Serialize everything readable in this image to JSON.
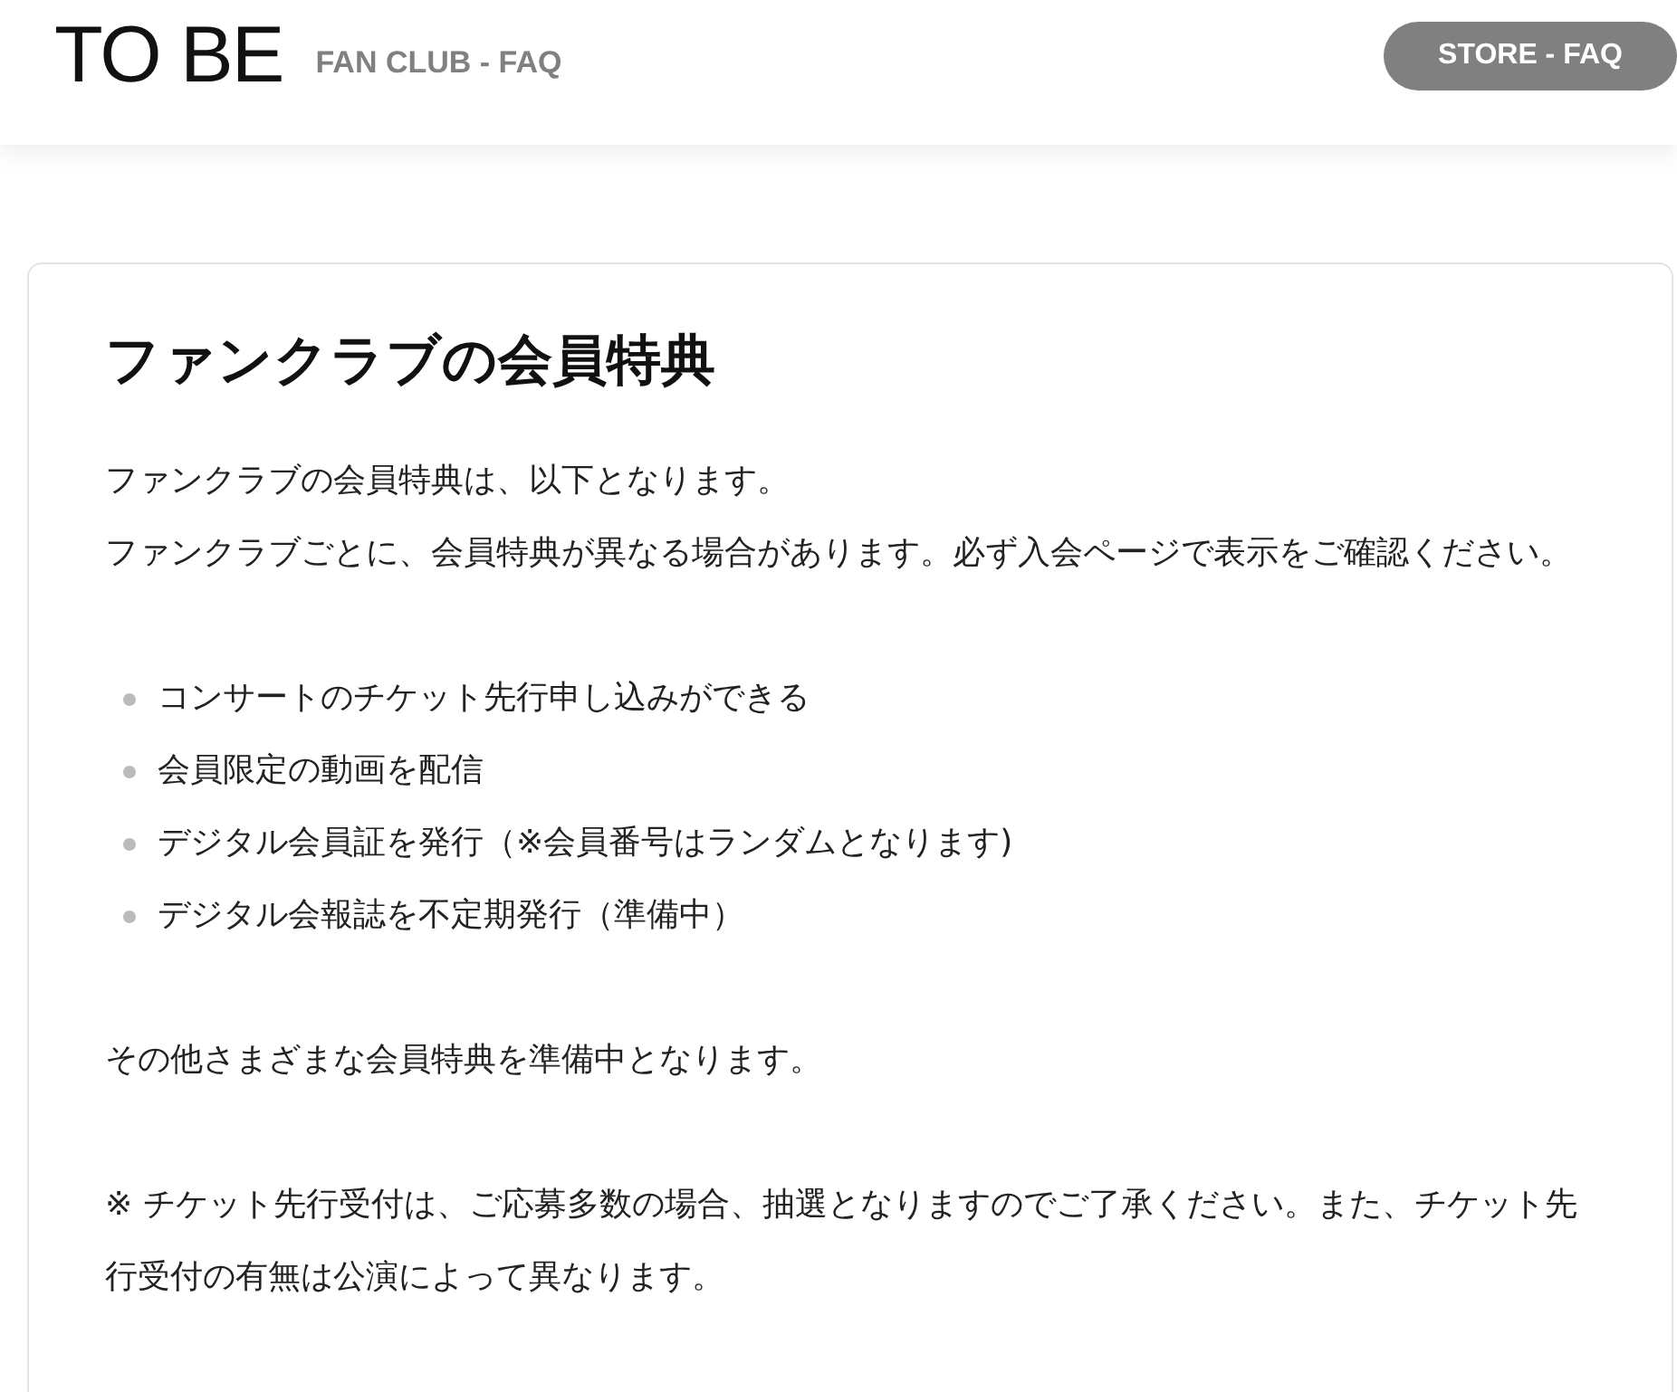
{
  "header": {
    "logo": "TO BE",
    "subtitle": "FAN CLUB - FAQ",
    "store_button": "STORE - FAQ"
  },
  "article": {
    "title": "ファンクラブの会員特典",
    "intro_lines": [
      "ファンクラブの会員特典は、以下となります。",
      "ファンクラブごとに、会員特典が異なる場合があります。必ず入会ページで表示をご確認ください。"
    ],
    "benefits": [
      "コンサートのチケット先行申し込みができる",
      "会員限定の動画を配信",
      "デジタル会員証を発行（※会員番号はランダムとなります)",
      "デジタル会報誌を不定期発行（準備中）"
    ],
    "paragraphs": [
      "その他さまざまな会員特典を準備中となります。",
      "※ チケット先行受付は、ご応募多数の場合、抽選となりますのでご了承ください。また、チケット先行受付の有無は公演によって異なります。"
    ]
  }
}
